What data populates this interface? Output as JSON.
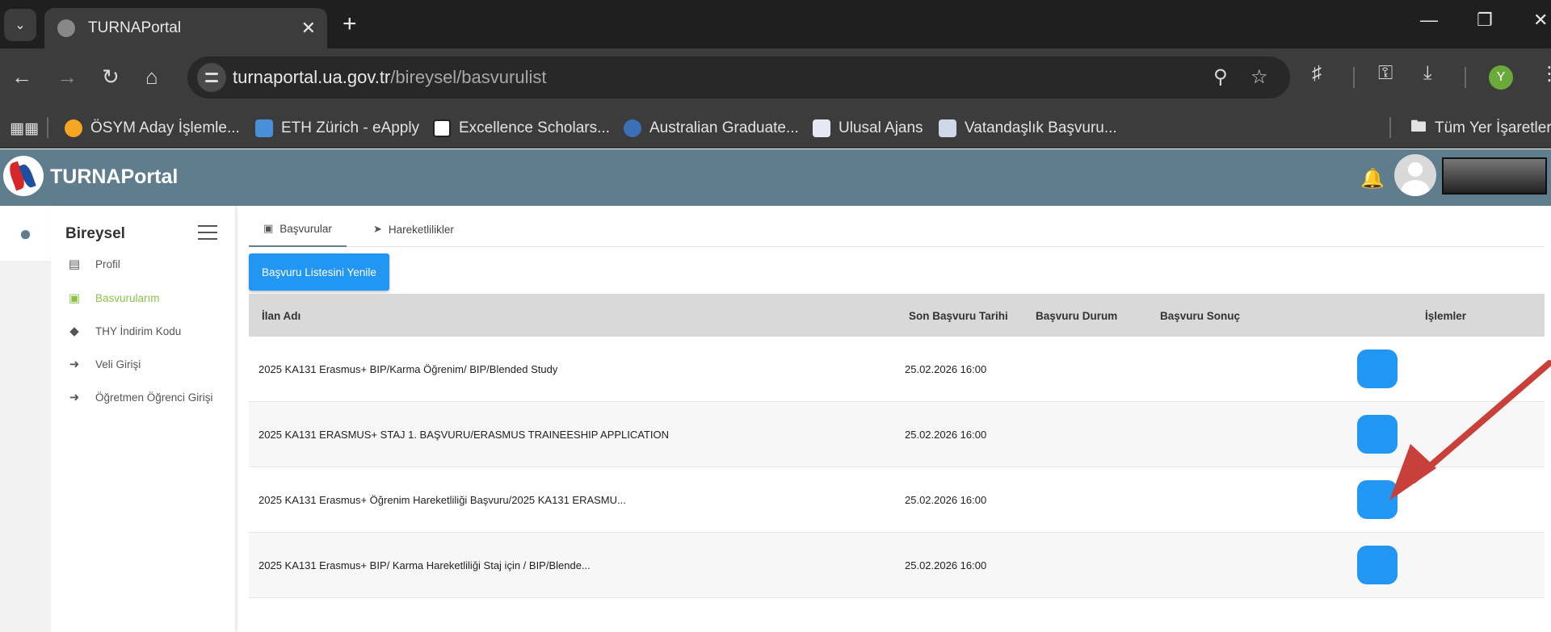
{
  "browser": {
    "tab_title": "TURNAPortal",
    "url_domain": "turnaportal.ua.gov.tr",
    "url_path": "/bireysel/basvurulist",
    "profile_initial": "Y",
    "bookmarks": [
      {
        "label": "ÖSYM Aday İşlemle...",
        "icon": "osym-icon",
        "color": "#f5a623"
      },
      {
        "label": "ETH Zürich - eApply",
        "icon": "eth-icon",
        "color": "#4a90d9"
      },
      {
        "label": "Excellence Scholars...",
        "icon": "eth-badge-icon",
        "color": "#ffffff"
      },
      {
        "label": "Australian Graduate...",
        "icon": "globe-icon",
        "color": "#3b6fb6"
      },
      {
        "label": "Ulusal Ajans",
        "icon": "ulusal-ajans-icon",
        "color": "#e8e8f4"
      },
      {
        "label": "Vatandaşlık Başvuru...",
        "icon": "document-icon",
        "color": "#cfd8e6"
      }
    ],
    "all_bookmarks_label": "Tüm Yer İşaretleri"
  },
  "app": {
    "name": "TURNAPortal",
    "header_color": "#5f7d8d"
  },
  "sidebar": {
    "title": "Bireysel",
    "items": [
      {
        "label": "Profil",
        "icon": "id-card-icon",
        "active": false
      },
      {
        "label": "Basvurularım",
        "icon": "clipboard-icon",
        "active": true
      },
      {
        "label": "THY İndirim Kodu",
        "icon": "tag-icon",
        "active": false
      },
      {
        "label": "Veli Girişi",
        "icon": "sign-in-icon",
        "active": false
      },
      {
        "label": "Öğretmen Öğrenci Girişi",
        "icon": "sign-in-icon",
        "active": false
      }
    ]
  },
  "content": {
    "tabs": [
      {
        "label": "Başvurular",
        "icon": "clipboard-icon",
        "active": true
      },
      {
        "label": "Hareketlilikler",
        "icon": "paper-plane-icon",
        "active": false
      }
    ],
    "refresh_button": "Başvuru Listesini Yenile",
    "table": {
      "columns": [
        "İlan Adı",
        "Son Başvuru Tarihi",
        "Başvuru Durum",
        "Başvuru Sonuç",
        "İşlemler"
      ],
      "rows": [
        {
          "name": "2025 KA131 Erasmus+ BIP/Karma Öğrenim/ BIP/Blended Study",
          "deadline": "25.02.2026 16:00",
          "status": "",
          "result": ""
        },
        {
          "name": "2025 KA131 ERASMUS+ STAJ 1. BAŞVURU/ERASMUS TRAINEESHIP APPLICATION",
          "deadline": "25.02.2026 16:00",
          "status": "",
          "result": ""
        },
        {
          "name": "2025 KA131 Erasmus+ Öğrenim Hareketliliği Başvuru/2025 KA131 ERASMU...",
          "deadline": "25.02.2026 16:00",
          "status": "",
          "result": ""
        },
        {
          "name": "2025 KA131 Erasmus+ BIP/ Karma Hareketliliği Staj için / BIP/Blende...",
          "deadline": "25.02.2026 16:00",
          "status": "",
          "result": ""
        }
      ]
    },
    "accent_color": "#2196f3",
    "active_color": "#8bc34a"
  }
}
